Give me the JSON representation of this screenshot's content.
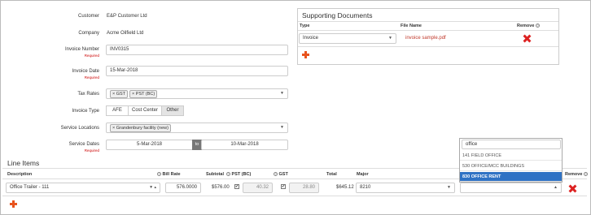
{
  "form": {
    "customer": {
      "label": "Customer",
      "value": "E&P Customer Ltd"
    },
    "company": {
      "label": "Company",
      "value": "Acme Oilfield Ltd"
    },
    "invoice_number": {
      "label": "Invoice Number",
      "required": "Required",
      "value": "INV0315"
    },
    "invoice_date": {
      "label": "Invoice Date",
      "required": "Required",
      "value": "15-Mar-2018"
    },
    "tax_rates": {
      "label": "Tax Rates",
      "tags": [
        "× GST",
        "× PST (BC)"
      ]
    },
    "invoice_type": {
      "label": "Invoice Type",
      "options": [
        "AFE",
        "Cost Center",
        "Other"
      ],
      "selected": "Other"
    },
    "service_locations": {
      "label": "Service Locations",
      "tags": [
        "× Grandenbury facility (new)"
      ]
    },
    "service_dates": {
      "label": "Service Dates",
      "required": "Required",
      "from": "5-Mar-2018",
      "to_label": "to",
      "to": "10-Mar-2018"
    }
  },
  "supporting_documents": {
    "title": "Supporting Documents",
    "headers": {
      "type": "Type",
      "file_name": "File Name",
      "remove": "Remove"
    },
    "rows": [
      {
        "type": "Invoice",
        "file_name": "invoice sample.pdf"
      }
    ]
  },
  "line_items": {
    "title": "Line Items",
    "headers": {
      "description": "Description",
      "bill_rate": "Bill Rate",
      "subtotal": "Subtotal",
      "pst": "PST (BC)",
      "gst": "GST",
      "total": "Total",
      "major": "Major",
      "remove": "Remove"
    },
    "rows": [
      {
        "description": "Office Trailer - 111",
        "bill_rate": "576.0000",
        "subtotal": "$576.00",
        "pst_checked": "✔",
        "pst": "40.32",
        "gst_checked": "✔",
        "gst": "28.80",
        "total": "$645.12",
        "major": "8210"
      }
    ]
  },
  "dropdown": {
    "search_value": "office",
    "options": [
      "141 FIELD OFFICE",
      "530 OFFICE/MCC BUILDINGS",
      "830 OFFICE RENT"
    ],
    "selected_index": 2
  },
  "colors": {
    "accent_orange": "#e8531d",
    "remove_red": "#d22222",
    "selected_blue": "#2f72c4"
  }
}
